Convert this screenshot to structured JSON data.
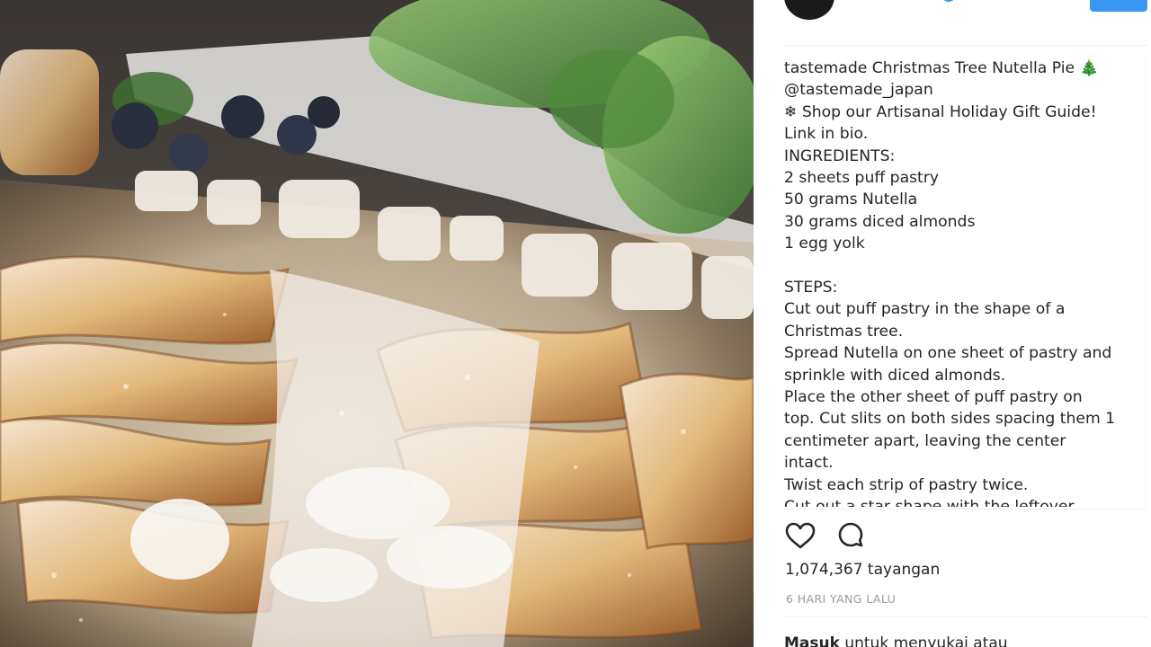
{
  "post": {
    "username": "tastemade",
    "caption_lines": [
      " Christmas Tree Nutella Pie 🎄",
      "@tastemade_japan",
      "❄ Shop our Artisanal Holiday Gift Guide!",
      "Link in bio.",
      "INGREDIENTS:",
      "2 sheets puff pastry",
      "50 grams Nutella",
      "30 grams diced almonds",
      "1 egg yolk",
      "",
      "STEPS:",
      "Cut out puff pastry in the shape of a",
      "Christmas tree.",
      "Spread Nutella on one sheet of pastry and",
      "sprinkle with diced almonds.",
      "Place the other sheet of puff pastry on",
      "top. Cut slits on both sides spacing them 1",
      "centimeter apart, leaving the center",
      "intact.",
      "Twist each strip of pastry twice.",
      "Cut out a star shape with the leftover"
    ],
    "views": "1,074,367 tayangan",
    "timestamp": "6 HARI YANG LALU",
    "comment_prompt": {
      "link": "Masuk",
      "text": " untuk menyukai atau"
    }
  },
  "icons": {
    "like": "heart-icon",
    "comment": "comment-icon"
  },
  "colors": {
    "accent": "#3897f0",
    "text": "#262626",
    "muted": "#999999",
    "divider": "#efefef"
  }
}
